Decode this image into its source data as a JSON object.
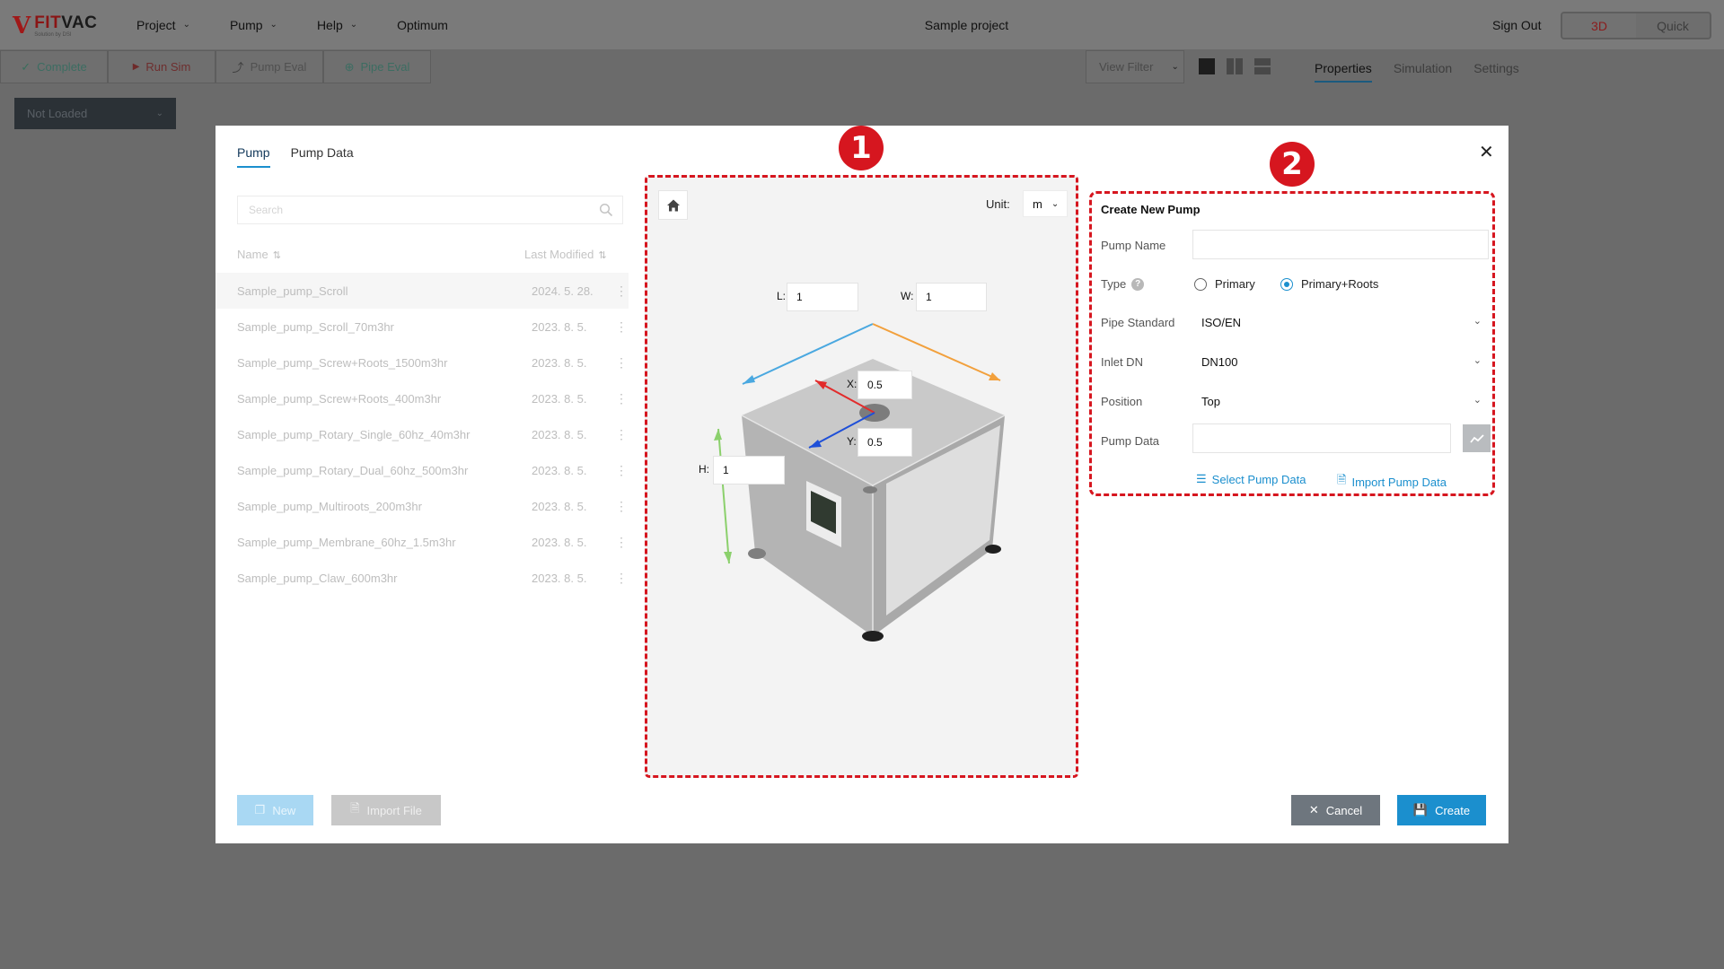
{
  "app": {
    "logo_mark": "V",
    "logo_word_1": "FIT",
    "logo_word_2": "VAC",
    "logo_tagline": "Solution by DSI",
    "nav": [
      {
        "label": "Project"
      },
      {
        "label": "Pump"
      },
      {
        "label": "Help"
      },
      {
        "label": "Optimum"
      }
    ],
    "project_name": "Sample project",
    "sign_out": "Sign Out",
    "mode": {
      "three_d": "3D",
      "quick": "Quick",
      "active": "3D"
    }
  },
  "toolbar": {
    "complete": "Complete",
    "run_sim": "Run Sim",
    "pump_eval": "Pump Eval",
    "pipe_eval": "Pipe Eval",
    "view_filter": "View Filter"
  },
  "right_tabs": {
    "properties": "Properties",
    "simulation": "Simulation",
    "settings": "Settings",
    "active": "Properties"
  },
  "not_loaded": "Not Loaded",
  "modal": {
    "tabs": [
      {
        "label": "Pump",
        "active": true
      },
      {
        "label": "Pump Data",
        "active": false
      }
    ],
    "search_placeholder": "Search",
    "columns": {
      "name": "Name",
      "modified": "Last Modified"
    },
    "pumps": [
      {
        "name": "Sample_pump_Scroll",
        "date": "2024. 5. 28."
      },
      {
        "name": "Sample_pump_Scroll_70m3hr",
        "date": "2023. 8. 5."
      },
      {
        "name": "Sample_pump_Screw+Roots_1500m3hr",
        "date": "2023. 8. 5."
      },
      {
        "name": "Sample_pump_Screw+Roots_400m3hr",
        "date": "2023. 8. 5."
      },
      {
        "name": "Sample_pump_Rotary_Single_60hz_40m3hr",
        "date": "2023. 8. 5."
      },
      {
        "name": "Sample_pump_Rotary_Dual_60hz_500m3hr",
        "date": "2023. 8. 5."
      },
      {
        "name": "Sample_pump_Multiroots_200m3hr",
        "date": "2023. 8. 5."
      },
      {
        "name": "Sample_pump_Membrane_60hz_1.5m3hr",
        "date": "2023. 8. 5."
      },
      {
        "name": "Sample_pump_Claw_600m3hr",
        "date": "2023. 8. 5."
      }
    ],
    "new_button": "New",
    "import_button": "Import File",
    "cancel_button": "Cancel",
    "create_button": "Create"
  },
  "viewer": {
    "unit_label": "Unit:",
    "unit_value": "m",
    "length": {
      "label": "L:",
      "value": "1"
    },
    "width": {
      "label": "W:",
      "value": "1"
    },
    "height": {
      "label": "H:",
      "value": "1"
    },
    "x": {
      "label": "X:",
      "value": "0.5"
    },
    "y": {
      "label": "Y:",
      "value": "0.5"
    }
  },
  "create_form": {
    "title": "Create New Pump",
    "pump_name_label": "Pump Name",
    "pump_name_value": "",
    "type_label": "Type",
    "type_options": [
      "Primary",
      "Primary+Roots"
    ],
    "type_selected": "Primary+Roots",
    "pipe_standard_label": "Pipe Standard",
    "pipe_standard_value": "ISO/EN",
    "inlet_dn_label": "Inlet DN",
    "inlet_dn_value": "DN100",
    "position_label": "Position",
    "position_value": "Top",
    "pump_data_label": "Pump Data",
    "pump_data_value": "",
    "select_link": "Select Pump Data",
    "import_link": "Import Pump Data"
  },
  "annotations": {
    "badge_1": "1",
    "badge_2": "2"
  },
  "colors": {
    "accent": "#1b8fce",
    "highlight": "#d6161f",
    "brand_red": "#8a1515",
    "axis_x": "#e22b2b",
    "axis_y": "#1e4fd8",
    "axis_l": "#4aa8e0",
    "axis_w": "#f2a03c",
    "axis_h": "#8bd06c"
  }
}
